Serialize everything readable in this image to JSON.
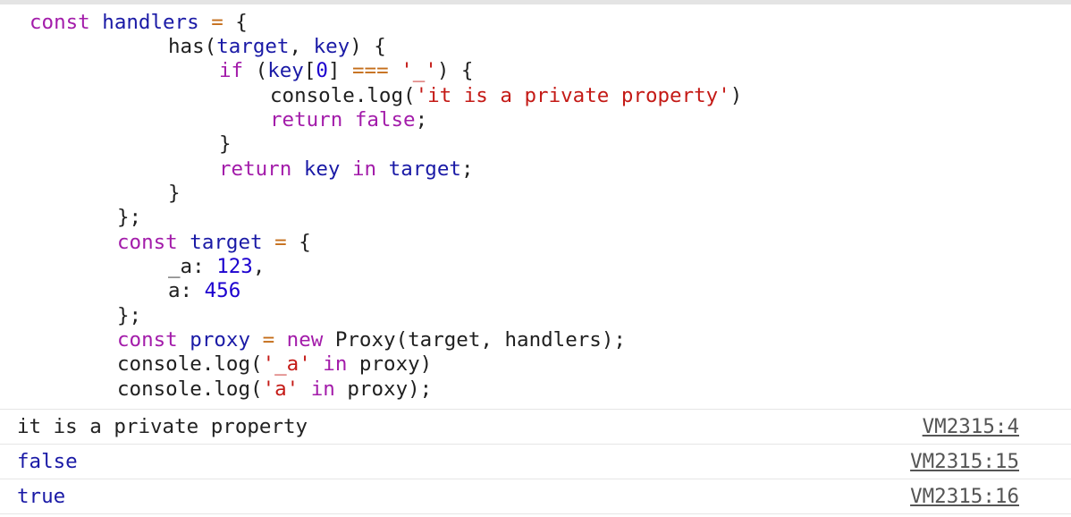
{
  "code_lines": [
    [
      {
        "t": "const",
        "c": "kw"
      },
      {
        "t": " ",
        "c": "plain"
      },
      {
        "t": "handlers",
        "c": "var"
      },
      {
        "t": " ",
        "c": "plain"
      },
      {
        "t": "=",
        "c": "op"
      },
      {
        "t": " {",
        "c": "plain"
      }
    ],
    [
      {
        "t": "has(",
        "c": "plain"
      },
      {
        "t": "target",
        "c": "var"
      },
      {
        "t": ", ",
        "c": "plain"
      },
      {
        "t": "key",
        "c": "var"
      },
      {
        "t": ") {",
        "c": "plain"
      }
    ],
    [
      {
        "t": "if",
        "c": "kw"
      },
      {
        "t": " (",
        "c": "plain"
      },
      {
        "t": "key",
        "c": "var"
      },
      {
        "t": "[",
        "c": "plain"
      },
      {
        "t": "0",
        "c": "num"
      },
      {
        "t": "] ",
        "c": "plain"
      },
      {
        "t": "===",
        "c": "op"
      },
      {
        "t": " ",
        "c": "plain"
      },
      {
        "t": "'_'",
        "c": "str"
      },
      {
        "t": ") {",
        "c": "plain"
      }
    ],
    [
      {
        "t": "console.log(",
        "c": "plain"
      },
      {
        "t": "'it is a private property'",
        "c": "str"
      },
      {
        "t": ")",
        "c": "plain"
      }
    ],
    [
      {
        "t": "return",
        "c": "kw"
      },
      {
        "t": " ",
        "c": "plain"
      },
      {
        "t": "false",
        "c": "kw"
      },
      {
        "t": ";",
        "c": "plain"
      }
    ],
    [
      {
        "t": "}",
        "c": "plain"
      }
    ],
    [
      {
        "t": "return",
        "c": "kw"
      },
      {
        "t": " ",
        "c": "plain"
      },
      {
        "t": "key",
        "c": "var"
      },
      {
        "t": " ",
        "c": "plain"
      },
      {
        "t": "in",
        "c": "kw"
      },
      {
        "t": " ",
        "c": "plain"
      },
      {
        "t": "target",
        "c": "var"
      },
      {
        "t": ";",
        "c": "plain"
      }
    ],
    [
      {
        "t": "}",
        "c": "plain"
      }
    ],
    [
      {
        "t": "};",
        "c": "plain"
      }
    ],
    [
      {
        "t": "const",
        "c": "kw"
      },
      {
        "t": " ",
        "c": "plain"
      },
      {
        "t": "target",
        "c": "var"
      },
      {
        "t": " ",
        "c": "plain"
      },
      {
        "t": "=",
        "c": "op"
      },
      {
        "t": " {",
        "c": "plain"
      }
    ],
    [
      {
        "t": "_a: ",
        "c": "plain"
      },
      {
        "t": "123",
        "c": "num"
      },
      {
        "t": ",",
        "c": "plain"
      }
    ],
    [
      {
        "t": "a: ",
        "c": "plain"
      },
      {
        "t": "456",
        "c": "num"
      }
    ],
    [
      {
        "t": "};",
        "c": "plain"
      }
    ],
    [
      {
        "t": "const",
        "c": "kw"
      },
      {
        "t": " ",
        "c": "plain"
      },
      {
        "t": "proxy",
        "c": "var"
      },
      {
        "t": " ",
        "c": "plain"
      },
      {
        "t": "=",
        "c": "op"
      },
      {
        "t": " ",
        "c": "plain"
      },
      {
        "t": "new",
        "c": "kw"
      },
      {
        "t": " Proxy(target, handlers);",
        "c": "plain"
      }
    ],
    [
      {
        "t": "console.log(",
        "c": "plain"
      },
      {
        "t": "'_a'",
        "c": "str"
      },
      {
        "t": " ",
        "c": "plain"
      },
      {
        "t": "in",
        "c": "kw"
      },
      {
        "t": " proxy)",
        "c": "plain"
      }
    ],
    [
      {
        "t": "console.log(",
        "c": "plain"
      },
      {
        "t": "'a'",
        "c": "str"
      },
      {
        "t": " ",
        "c": "plain"
      },
      {
        "t": "in",
        "c": "kw"
      },
      {
        "t": " proxy);",
        "c": "plain"
      }
    ]
  ],
  "output": [
    {
      "message": "it is a private property",
      "kind": "plain",
      "source": "VM2315:4"
    },
    {
      "message": "false",
      "kind": "bool",
      "source": "VM2315:15"
    },
    {
      "message": "true",
      "kind": "bool",
      "source": "VM2315:16"
    }
  ],
  "colors": {
    "keyword": "#a31caa",
    "variable": "#1a1aa6",
    "string": "#c41a16",
    "number": "#1c00cf",
    "operator": "#c56e1a",
    "boolean_output": "#1a1aa6",
    "source_link": "#555555"
  }
}
